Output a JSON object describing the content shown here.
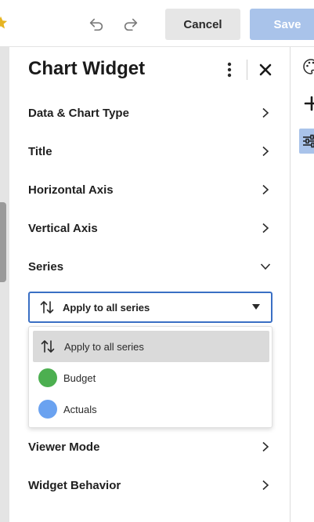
{
  "toolbar": {
    "cancel_label": "Cancel",
    "save_label": "Save",
    "icons": [
      "star-icon",
      "undo-icon",
      "redo-icon"
    ]
  },
  "panel": {
    "title": "Chart Widget",
    "sections": [
      {
        "label": "Data & Chart Type",
        "state": "collapsed"
      },
      {
        "label": "Title",
        "state": "collapsed"
      },
      {
        "label": "Horizontal Axis",
        "state": "collapsed"
      },
      {
        "label": "Vertical Axis",
        "state": "collapsed"
      },
      {
        "label": "Series",
        "state": "expanded"
      },
      {
        "label": "Viewer Mode",
        "state": "collapsed"
      },
      {
        "label": "Widget Behavior",
        "state": "collapsed"
      }
    ],
    "series_select": {
      "value": "Apply to all series",
      "options": [
        {
          "label": "Apply to all series",
          "icon": "sort-icon",
          "selected": true
        },
        {
          "label": "Budget",
          "color": "#4caf50"
        },
        {
          "label": "Actuals",
          "color": "#6aa2f0"
        }
      ]
    }
  },
  "colors": {
    "accent": "#3a6fc4",
    "save_disabled": "#a9c3ea",
    "cancel_bg": "#e6e6e6"
  }
}
